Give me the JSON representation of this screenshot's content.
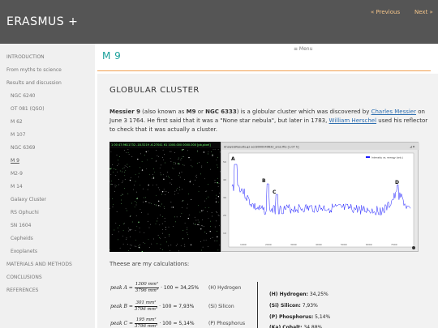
{
  "header": {
    "site_title": "ERASMUS +",
    "prev_label": "« Previous",
    "next_label": "Next »"
  },
  "sidebar": {
    "items": [
      {
        "label": "INTRODUCTION",
        "level": "top"
      },
      {
        "label": "From myths to science",
        "level": "top"
      },
      {
        "label": "Results and discussion",
        "level": "top"
      },
      {
        "label": "NGC 6240",
        "level": "sub"
      },
      {
        "label": "OT 081 (QSO)",
        "level": "sub"
      },
      {
        "label": "M 62",
        "level": "sub"
      },
      {
        "label": "M 107",
        "level": "sub"
      },
      {
        "label": "NGC 6369",
        "level": "sub"
      },
      {
        "label": "M 9",
        "level": "sub",
        "active": true
      },
      {
        "label": "M2-9",
        "level": "sub"
      },
      {
        "label": "M 14",
        "level": "sub"
      },
      {
        "label": "Galaxy Cluster",
        "level": "sub"
      },
      {
        "label": "RS Ophuchi",
        "level": "sub"
      },
      {
        "label": "SN 1604",
        "level": "sub"
      },
      {
        "label": "Cepheids",
        "level": "sub"
      },
      {
        "label": "Exoplanets",
        "level": "sub"
      },
      {
        "label": "MATERIALS AND METHODS",
        "level": "top"
      },
      {
        "label": "CONCLUSIONS",
        "level": "top"
      },
      {
        "label": "REFERENCES",
        "level": "top"
      }
    ]
  },
  "main": {
    "menu_label": "≡ Menu",
    "page_title": "M 9",
    "section_heading": "GLOBULAR CLUSTER",
    "intro": {
      "t1": "Messier 9",
      "t2": " (also known as ",
      "t3": "M9",
      "t4": " or ",
      "t5": "NGC 6333",
      "t6": ") is a globular cluster which was discovered by ",
      "link1": "Charles Messier",
      "t7": " on June 3 1764. He first said that it was a \"None star nebula\", but later in 1783, ",
      "link2": "William Herschel",
      "t8": " used his reflector to check that it was actually a cluster."
    },
    "star_image_status": "1 00   47.9611732  -18.5219 -6.27041  61   1000.000 0000.000 [pb,pixel]",
    "spectrum": {
      "window_title": "AnalysisResults.gz  acc8000049632_ars2.fits [1.07 h]",
      "legend": "Intensity vs. energy (arb.)",
      "peak_labels": [
        "A",
        "B",
        "C",
        "D"
      ],
      "x_ticks": [
        "1000",
        "2000",
        "3000",
        "4000",
        "5000",
        "6000",
        "7000"
      ],
      "y_ticks": [
        "50",
        "40",
        "30",
        "20",
        "10"
      ],
      "line_color": "#1a1aff"
    },
    "calc_intro": "Theese are my calculations:",
    "equations": [
      {
        "lhs": "peak A =",
        "num": "1300 mm²",
        "den": "3796 mm²",
        "tail": "· 100 = 34,25%",
        "label": "(H) Hydrogen"
      },
      {
        "lhs": "peak B =",
        "num": "301 mm²",
        "den": "3796 mm²",
        "tail": "· 100 = 7,93%",
        "label": "(Si) Silicon"
      },
      {
        "lhs": "peak C =",
        "num": "195 mm²",
        "den": "3796 mm²",
        "tail": "· 100 = 5,14%",
        "label": "(P) Phosphorus"
      }
    ],
    "results": [
      {
        "name": "(H) Hydrogen:",
        "value": " 34,25%"
      },
      {
        "name": "(Si) Silicon:",
        "value": " 7,93%"
      },
      {
        "name": "(P) Phosphorus:",
        "value": " 5,14%"
      },
      {
        "name": "(Ka) Cobalt:",
        "value": " 34,88%"
      }
    ]
  },
  "colors": {
    "accent": "#19a09a",
    "rule": "#f0a050",
    "link": "#2f6fb0",
    "header_bg": "#555555",
    "nav_link_header": "#f4c58a"
  }
}
